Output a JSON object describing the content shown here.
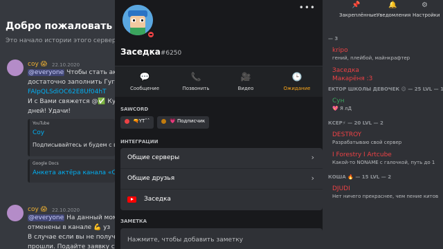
{
  "left": {
    "welcome_title": "Добро пожаловать на с",
    "welcome_sub": "Это начало истории этого сервера.",
    "messages": [
      {
        "author": "coy 😱",
        "time": "22.10.2020",
        "line1_mention": "@everyone",
        "line1": "Чтобы стать актё",
        "line2": "достаточно заполнить Гугл Ф",
        "line3": "FAIpQLSdiOC62E8Uf04hT",
        "line4": "И с Вами свяжется @✅ Кур",
        "line5": "дней! Удачи!",
        "embed1_provider": "YouTube",
        "embed1_title": "Coy",
        "embed1_desc": "Подписывайтесь и будем с вам",
        "embed2_provider": "Google Docs",
        "embed2_title": "Анкета актёра канала «Coy"
      },
      {
        "author": "coy 😱",
        "time": "22.10.2020",
        "line1_mention": "@everyone",
        "line1": "На данный момен",
        "line2": "отменены в канале 💪 уз",
        "line3": "В случае если вы не получил",
        "line4": "прошли. Подайте заявку с"
      }
    ]
  },
  "right": {
    "topbar": [
      {
        "icon": "pin-icon",
        "glyph": "📌",
        "label": "Закреплённые"
      },
      {
        "icon": "bell-icon",
        "glyph": "🔔",
        "label": "Уведомления"
      },
      {
        "icon": "gear-icon",
        "glyph": "⚙",
        "label": "Настройки"
      }
    ],
    "members": [
      {
        "kind": "cat",
        "text": "— 3"
      },
      {
        "kind": "name",
        "text": "kripo",
        "color": "#ed4245"
      },
      {
        "kind": "status",
        "text": "гений, плейбой, майнкрафтер"
      },
      {
        "kind": "name",
        "text": "Заседка",
        "color": "#ed4245"
      },
      {
        "kind": "name",
        "text": "Макарёня :3",
        "color": "#ed4245"
      },
      {
        "kind": "cat",
        "text": "ЕКТОР ШКОЛЫ ДЕВОЧЕК 😉 — 25 LVL — 1"
      },
      {
        "kind": "name",
        "text": "Сун",
        "color": "#3ba55d"
      },
      {
        "kind": "status",
        "text": "💖 Я лД"
      },
      {
        "kind": "cat",
        "text": "КСЕР⚡ — 20 LVL — 2"
      },
      {
        "kind": "name",
        "text": "DESTROY",
        "color": "#ed4245"
      },
      {
        "kind": "status",
        "text": "Разрабатываю свой сервер"
      },
      {
        "kind": "name",
        "text": "I Forestry I Artcube",
        "color": "#ed4245"
      },
      {
        "kind": "status",
        "text": "Какой-то NONAME с галочкой, путь до 1"
      },
      {
        "kind": "cat",
        "text": "КОША 🔥 — 15 LVL — 2"
      },
      {
        "kind": "name",
        "text": "DJUDI",
        "color": "#ed4245"
      },
      {
        "kind": "status",
        "text": "Нет ничего прекраснее, чем пение китов"
      }
    ]
  },
  "profile": {
    "more_glyph": "•••",
    "name": "Заседка",
    "tag": "#6250",
    "actions": [
      {
        "icon": "message-icon",
        "glyph": "💬",
        "label": "Сообщение",
        "active": false
      },
      {
        "icon": "phone-icon",
        "glyph": "📞",
        "label": "Позвонить",
        "active": false
      },
      {
        "icon": "video-icon",
        "glyph": "🎥",
        "label": "Видео",
        "active": false
      },
      {
        "icon": "clock-icon",
        "glyph": "🕒",
        "label": "Ожидание",
        "active": true
      }
    ],
    "server_label": "SAWCORD",
    "connections": [
      {
        "text": "🔫YTˆˆ",
        "dot": "#ed4245"
      },
      {
        "text": "💗 Подписчик",
        "dot": "#c27c0e"
      }
    ],
    "integrations_label": "ИНТЕГРАЦИИ",
    "integrations": [
      {
        "label": "Общие серверы",
        "chevron": "›"
      },
      {
        "label": "Общие друзья",
        "chevron": "›"
      },
      {
        "label": "Заседка"
      }
    ],
    "note_label": "ЗАМЕТКА",
    "note_placeholder": "Нажмите, чтобы добавить заметку"
  },
  "colors": {
    "accent_active": "#faa61a",
    "status_dnd": "#ed4245",
    "link": "#00b0f4"
  }
}
